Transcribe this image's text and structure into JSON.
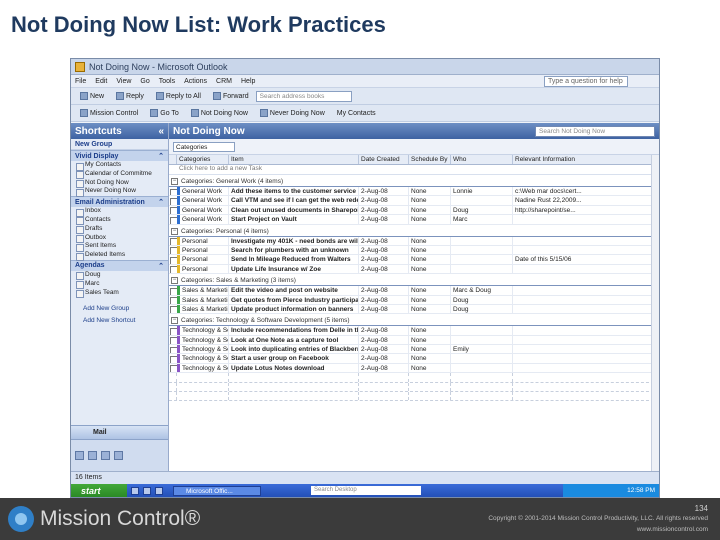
{
  "slide": {
    "title": "Not Doing Now List: Work Practices",
    "page_number": "134",
    "copyright": "Copyright © 2001-2014 Mission Control Productivity, LLC. All rights reserved",
    "website": "www.missioncontrol.com",
    "logo_text": "Mission Control®"
  },
  "window": {
    "title": "Not Doing Now - Microsoft Outlook",
    "menu": [
      "File",
      "Edit",
      "View",
      "Go",
      "Tools",
      "Actions",
      "CRM",
      "Help"
    ],
    "toolbar1": {
      "new": "New",
      "reply": "Reply",
      "reply_all": "Reply to All",
      "forward": "Forward",
      "search_address": "Search address books"
    },
    "help_placeholder": "Type a question for help",
    "toolbar2": {
      "mission_control": "Mission Control",
      "go_to": "Go To",
      "not_doing_now": "Not Doing Now",
      "never_doing_now": "Never Doing Now",
      "my_contacts": "My Contacts"
    }
  },
  "nav": {
    "header": "Shortcuts",
    "new_group": "New Group",
    "groups": [
      {
        "name": "Vivid Display",
        "items": [
          "My Contacts",
          "Calendar of Commitme",
          "Not Doing Now",
          "Never Doing Now"
        ]
      },
      {
        "name": "Email Administration",
        "items": [
          "Inbox",
          "Contacts",
          "Drafts",
          "Outbox",
          "Sent Items",
          "Deleted Items"
        ]
      },
      {
        "name": "Agendas",
        "items": [
          "Doug",
          "Marc",
          "Sales Team"
        ]
      }
    ],
    "add_group": "Add New Group",
    "add_shortcut": "Add New Shortcut",
    "mail": "Mail"
  },
  "view": {
    "title": "Not Doing Now",
    "search_placeholder": "Search Not Doing Now",
    "arrange": "Categories",
    "columns": [
      "Categories",
      "Item",
      "Date Created",
      "Schedule By",
      "Who",
      "Relevant Information"
    ],
    "new_item_hint": "Click here to add a new Task",
    "groups": [
      {
        "label": "Categories: General Work (4 items)",
        "rows": [
          {
            "cat": "General Work",
            "item": "Add these items to the customer service manual",
            "date": "2-Aug-08",
            "sched": "None",
            "who": "Lonnie",
            "info": "c:\\Web mar docs\\cert..."
          },
          {
            "cat": "General Work",
            "item": "Call VTM and see if I can get the web redesign li...",
            "date": "2-Aug-08",
            "sched": "None",
            "who": "",
            "info": "Nadine Rust 22,2009..."
          },
          {
            "cat": "General Work",
            "item": "Clean out unused documents in Sharepoint",
            "date": "2-Aug-08",
            "sched": "None",
            "who": "Doug",
            "info": "http://sharepoint/se..."
          },
          {
            "cat": "General Work",
            "item": "Start Project on Vault",
            "date": "2-Aug-08",
            "sched": "None",
            "who": "Marc",
            "info": ""
          }
        ]
      },
      {
        "label": "Categories: Personal (4 items)",
        "rows": [
          {
            "cat": "Personal",
            "item": "Investigate my 401K - need bonds are will pay t...",
            "date": "2-Aug-08",
            "sched": "None",
            "who": "",
            "info": ""
          },
          {
            "cat": "Personal",
            "item": "Search for plumbers with an unknown",
            "date": "2-Aug-08",
            "sched": "None",
            "who": "",
            "info": ""
          },
          {
            "cat": "Personal",
            "item": "Send In Mileage Reduced from Walters",
            "date": "2-Aug-08",
            "sched": "None",
            "who": "",
            "info": "Date of this 5/15/06"
          },
          {
            "cat": "Personal",
            "item": "Update Life Insurance w/ Zoe",
            "date": "2-Aug-08",
            "sched": "None",
            "who": "",
            "info": ""
          }
        ]
      },
      {
        "label": "Categories: Sales & Marketing (3 items)",
        "rows": [
          {
            "cat": "Sales & Marketing",
            "item": "Edit the video and post on website",
            "date": "2-Aug-08",
            "sched": "None",
            "who": "Marc & Doug",
            "info": ""
          },
          {
            "cat": "Sales & Marketing",
            "item": "Get quotes from Pierce Industry participants for...",
            "date": "2-Aug-08",
            "sched": "None",
            "who": "Doug",
            "info": ""
          },
          {
            "cat": "Sales & Marketing",
            "item": "Update product information on banners",
            "date": "2-Aug-08",
            "sched": "None",
            "who": "Doug",
            "info": ""
          }
        ]
      },
      {
        "label": "Categories: Technology & Software Development (5 items)",
        "rows": [
          {
            "cat": "Technology & Softwar...",
            "item": "Include recommendations from Delle in the Outl...",
            "date": "2-Aug-08",
            "sched": "None",
            "who": "",
            "info": ""
          },
          {
            "cat": "Technology & Softwar...",
            "item": "Look at One Note as a capture tool",
            "date": "2-Aug-08",
            "sched": "None",
            "who": "",
            "info": ""
          },
          {
            "cat": "Technology & Softwar...",
            "item": "Look into duplicating entries of Blackberry",
            "date": "2-Aug-08",
            "sched": "None",
            "who": "Emily",
            "info": ""
          },
          {
            "cat": "Technology & Softwar...",
            "item": "Start a user group on Facebook",
            "date": "2-Aug-08",
            "sched": "None",
            "who": "",
            "info": ""
          },
          {
            "cat": "Technology & Softwar...",
            "item": "Update Lotus Notes download",
            "date": "2-Aug-08",
            "sched": "None",
            "who": "",
            "info": ""
          }
        ]
      }
    ]
  },
  "status_bar": "16 Items",
  "taskbar": {
    "start": "start",
    "task": "Microsoft Offic...",
    "search": "Search Desktop",
    "clock": "12:58 PM"
  }
}
